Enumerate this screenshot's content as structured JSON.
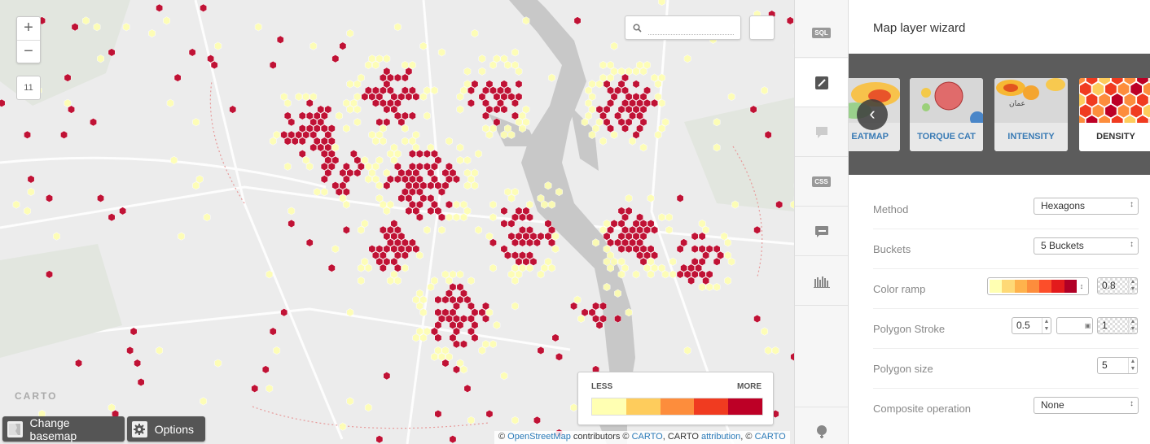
{
  "map": {
    "zoom_in": "+",
    "zoom_out": "−",
    "zoom_level": "11",
    "search_placeholder": "",
    "watermark": "CARTO",
    "legend": {
      "less_label": "LESS",
      "more_label": "MORE",
      "colors": [
        "#ffffb2",
        "#fecc5c",
        "#fd8d3c",
        "#f03b20",
        "#bd0026"
      ]
    },
    "change_basemap_label": "Change basemap",
    "options_label": "Options",
    "attribution": {
      "prefix": "©",
      "osm": "OpenStreetMap",
      "contrib": "contributors ©",
      "carto1": "CARTO",
      "mid": ", CARTO",
      "attr_link": "attribution",
      "sep": ", ©",
      "carto2": "CARTO"
    }
  },
  "rail": {
    "items": [
      {
        "icon": "sql-icon",
        "label": "SQL"
      },
      {
        "icon": "brush-icon"
      },
      {
        "icon": "infowindow-icon"
      },
      {
        "icon": "css-icon",
        "label": "CSS"
      },
      {
        "icon": "legend-icon"
      },
      {
        "icon": "filters-icon"
      },
      {
        "icon": "add-layer-icon"
      }
    ]
  },
  "panel": {
    "title": "Map layer wizard",
    "cards": [
      {
        "name": "EATMAP"
      },
      {
        "name": "TORQUE CAT"
      },
      {
        "name": "INTENSITY"
      },
      {
        "name": "DENSITY",
        "selected": true
      }
    ],
    "fields": {
      "method": {
        "label": "Method",
        "value": "Hexagons"
      },
      "buckets": {
        "label": "Buckets",
        "value": "5 Buckets"
      },
      "color_ramp": {
        "label": "Color ramp",
        "opacity": "0.8",
        "colors": [
          "#ffffb2",
          "#fed976",
          "#feb24c",
          "#fd8d3c",
          "#fc4e2a",
          "#e31a1c",
          "#b10026"
        ]
      },
      "polygon_stroke": {
        "label": "Polygon Stroke",
        "width": "0.5",
        "opacity": "1"
      },
      "polygon_size": {
        "label": "Polygon size",
        "value": "5"
      },
      "composite": {
        "label": "Composite operation",
        "value": "None"
      }
    }
  }
}
